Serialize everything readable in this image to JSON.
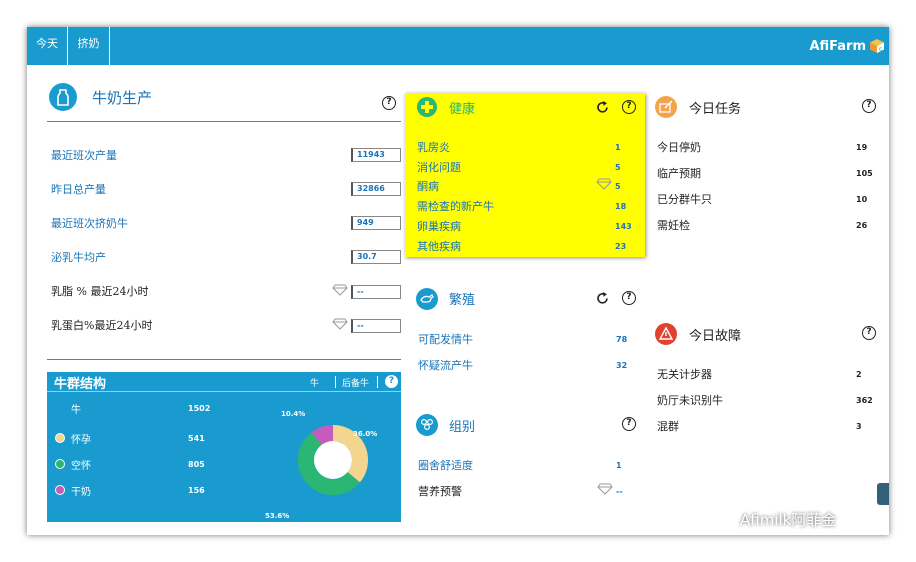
{
  "topbar": {
    "tabs": [
      "今天",
      "挤奶"
    ],
    "brand": "AfiFarm"
  },
  "milk_production": {
    "title": "牛奶生产",
    "rows": [
      {
        "label": "最近班次产量",
        "value": "11943"
      },
      {
        "label": "昨日总产量",
        "value": "32866"
      },
      {
        "label": "最近班次挤奶牛",
        "value": "949"
      },
      {
        "label": "泌乳牛均产",
        "value": "30.7"
      },
      {
        "label": "乳脂 % 最近24小时",
        "value": "--"
      },
      {
        "label": "乳蛋白%最近24小时",
        "value": "--"
      }
    ]
  },
  "herd_structure": {
    "title": "牛群结构",
    "toggle": [
      "牛",
      "后备牛"
    ],
    "total_label": "牛",
    "total_value": "1502",
    "items": [
      {
        "label": "怀孕",
        "value": "541",
        "color": "#f4d58d"
      },
      {
        "label": "空怀",
        "value": "805",
        "color": "#2bb673"
      },
      {
        "label": "干奶",
        "value": "156",
        "color": "#c55bbd"
      }
    ],
    "pie_labels": [
      "36.0%",
      "53.6%",
      "10.4%"
    ]
  },
  "health": {
    "title": "健康",
    "rows": [
      {
        "label": "乳房炎",
        "value": "1"
      },
      {
        "label": "消化问题",
        "value": "5"
      },
      {
        "label": "酮病",
        "value": "5"
      },
      {
        "label": "需检查的新产牛",
        "value": "18"
      },
      {
        "label": "卵巢疾病",
        "value": "143"
      },
      {
        "label": "其他疾病",
        "value": "23"
      }
    ],
    "accent": "#ffff00"
  },
  "reproduction": {
    "title": "繁殖",
    "rows": [
      {
        "label": "可配发情牛",
        "value": "78"
      },
      {
        "label": "怀疑流产牛",
        "value": "32"
      }
    ]
  },
  "groups": {
    "title": "组别",
    "rows": [
      {
        "label": "圈舍舒适度",
        "value": "1"
      },
      {
        "label": "营养预警",
        "value": "--"
      }
    ]
  },
  "tasks": {
    "title": "今日任务",
    "rows": [
      {
        "label": "今日停奶",
        "value": "19"
      },
      {
        "label": "临产预期",
        "value": "105"
      },
      {
        "label": "已分群牛只",
        "value": "10"
      },
      {
        "label": "需妊检",
        "value": "26"
      }
    ]
  },
  "faults": {
    "title": "今日故障",
    "rows": [
      {
        "label": "无关计步器",
        "value": "2"
      },
      {
        "label": "奶厅未识别牛",
        "value": "362"
      },
      {
        "label": "混群",
        "value": "3"
      }
    ]
  },
  "watermark": "Afimilk阿菲金",
  "colors": {
    "blue": "#1a9bd0",
    "text_blue": "#1a74b8",
    "orange": "#f4a34a",
    "red": "#e0422e"
  }
}
